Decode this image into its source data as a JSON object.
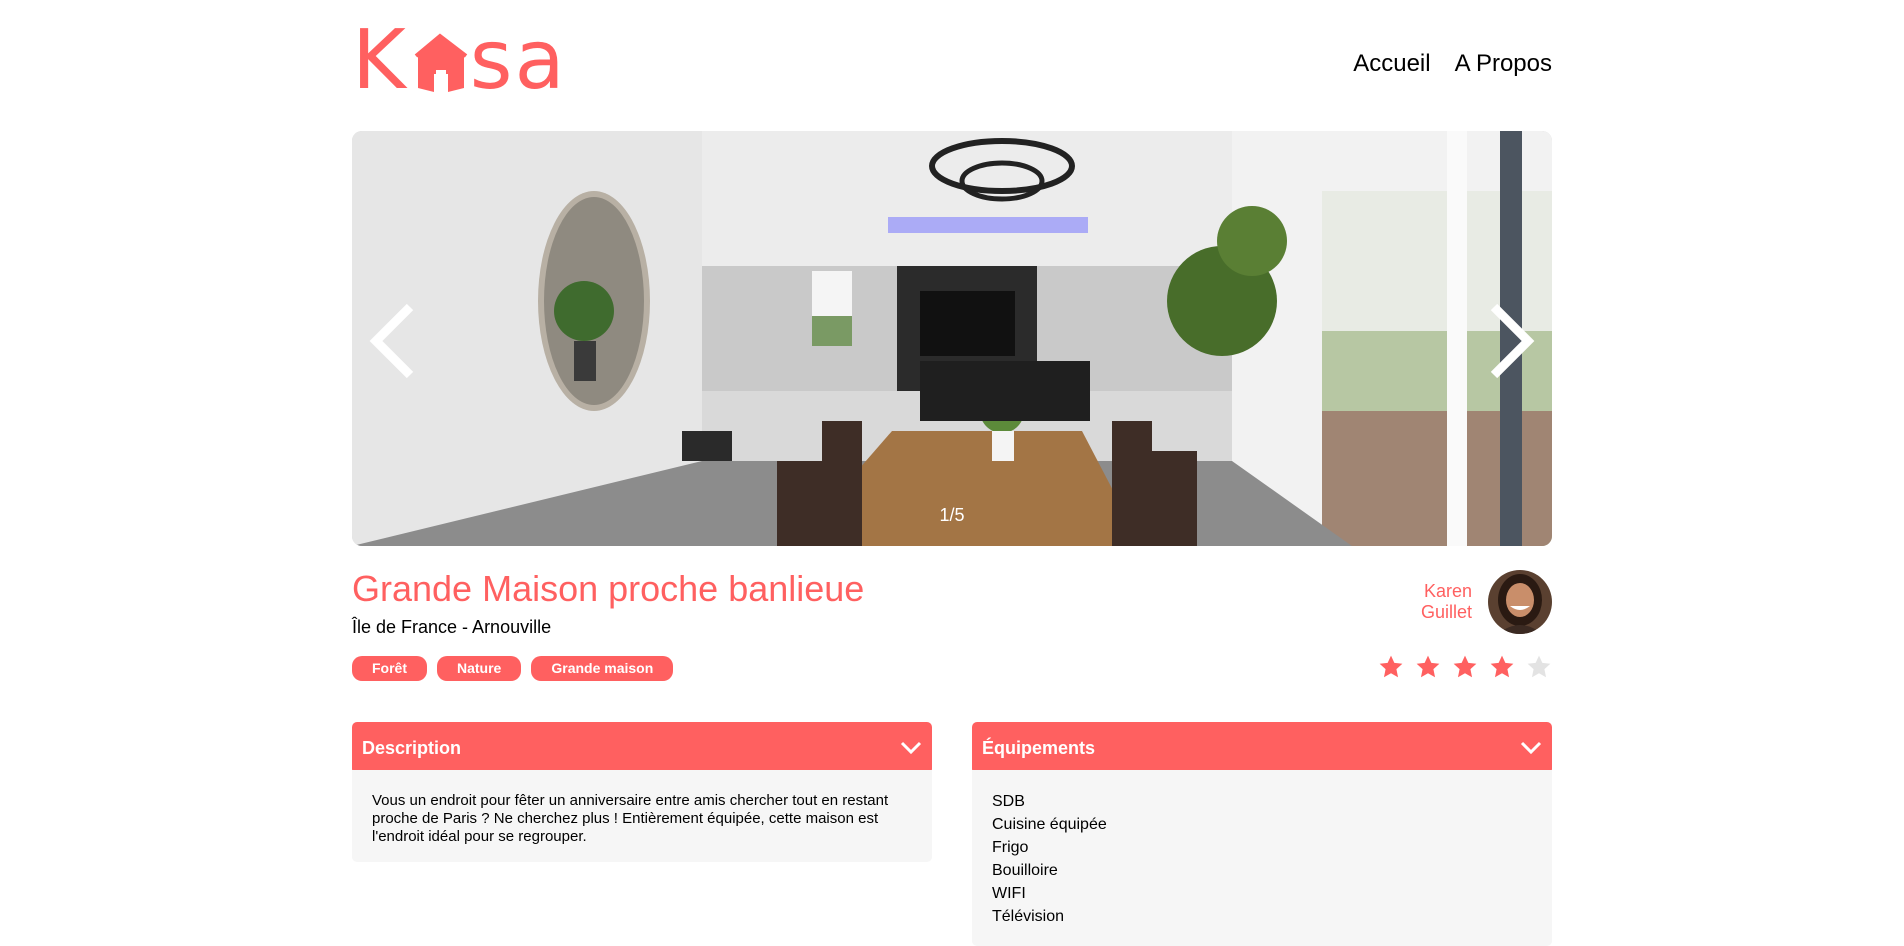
{
  "header": {
    "logo_left": "K",
    "logo_right": "sa",
    "nav": [
      {
        "label": "Accueil"
      },
      {
        "label": "A Propos"
      }
    ]
  },
  "gallery": {
    "counter": "1/5"
  },
  "listing": {
    "title": "Grande Maison proche banlieue",
    "location": "Île de France - Arnouville",
    "tags": [
      "Forêt",
      "Nature",
      "Grande maison"
    ],
    "host": {
      "first_name": "Karen",
      "last_name": "Guillet"
    },
    "rating": 4,
    "rating_max": 5
  },
  "description": {
    "label": "Description",
    "text": "Vous un endroit pour fêter un anniversaire entre amis chercher tout en restant proche de Paris ? Ne cherchez plus ! Entièrement équipée, cette maison est l'endroit idéal pour se regrouper."
  },
  "equipments": {
    "label": "Équipements",
    "items": [
      "SDB",
      "Cuisine équipée",
      "Frigo",
      "Bouilloire",
      "WIFI",
      "Télévision"
    ]
  },
  "colors": {
    "accent": "#FF6060",
    "star_off": "#E3E3E3",
    "panel_bg": "#F6F6F6"
  }
}
